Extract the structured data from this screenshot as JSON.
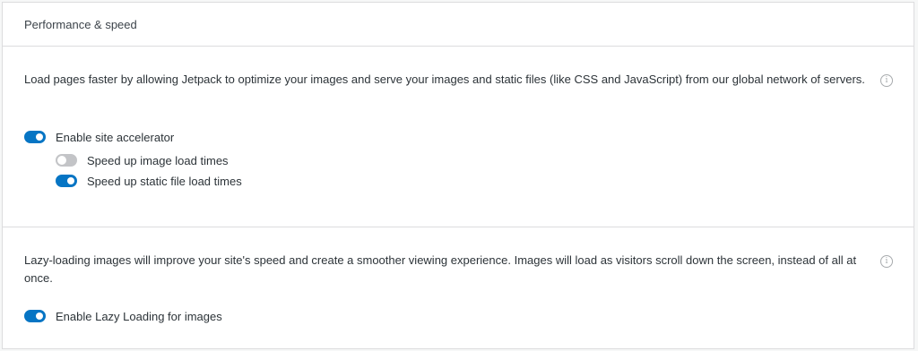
{
  "header": {
    "title": "Performance & speed"
  },
  "site_accelerator": {
    "description": "Load pages faster by allowing Jetpack to optimize your images and serve your images and static files (like CSS and JavaScript) from our global network of servers.",
    "info_icon": "info-icon",
    "enable": {
      "label": "Enable site accelerator",
      "enabled": true
    },
    "images": {
      "label": "Speed up image load times",
      "enabled": false
    },
    "static_files": {
      "label": "Speed up static file load times",
      "enabled": true
    }
  },
  "lazy_loading": {
    "description": "Lazy-loading images will improve your site's speed and create a smoother viewing experience. Images will load as visitors scroll down the screen, instead of all at once.",
    "info_icon": "info-icon",
    "enable": {
      "label": "Enable Lazy Loading for images",
      "enabled": true
    }
  },
  "colors": {
    "toggle_on": "#0675c4",
    "toggle_off": "#c3c4c7",
    "border": "#dcdcde",
    "background": "#f6f7f7"
  }
}
